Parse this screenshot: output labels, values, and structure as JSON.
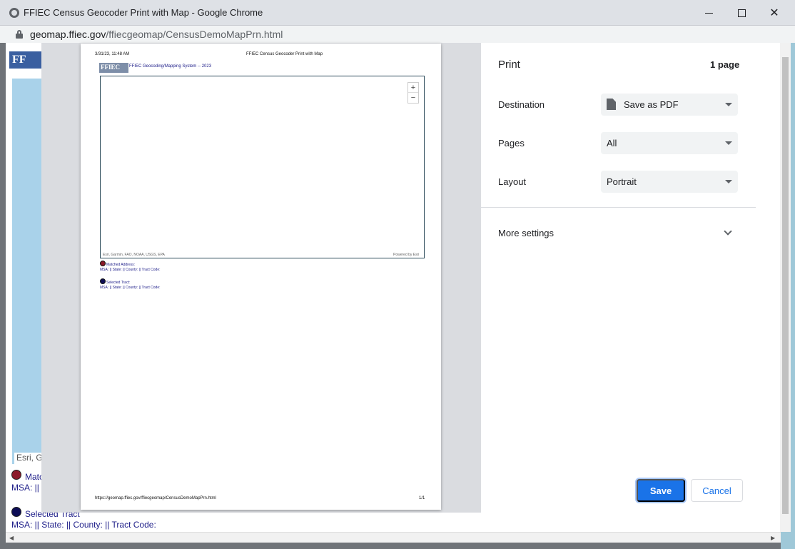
{
  "window": {
    "title": "FFIEC Census Geocoder Print with Map - Google Chrome",
    "url_host": "geomap.ffiec.gov",
    "url_path": "/ffiecgeomap/CensusDemoMapPrn.html"
  },
  "background_page": {
    "logo_text": "FF",
    "esri_text": "Esri, G",
    "matched_label": "Matc",
    "msa_line_1": "MSA: ||",
    "selected_label": "Selected Tract",
    "msa_line_2": "MSA: || State: || County: || Tract Code:"
  },
  "preview": {
    "date": "3/31/23, 11:48 AM",
    "header_title": "FFIEC Census Geocoder Print with Map",
    "logo_text": "FFIEC",
    "system_title": "FFIEC Geocoding/Mapping System -- 2023",
    "zoom_in": "+",
    "zoom_out": "−",
    "map_attribution": "Esri, Garmin, FAO, NOAA, USGS, EPA",
    "powered_by": "Powered by Esri",
    "matched_label": "Matched Address:",
    "matched_msa": "MSA: || State: || County: || Tract Code:",
    "selected_label": "Selected Tract:",
    "selected_msa": "MSA: || State: || County: || Tract Code:",
    "footer_url": "https://geomap.ffiec.gov/ffiecgeomap/CensusDemoMapPrn.html",
    "page_number": "1/1"
  },
  "print_settings": {
    "title": "Print",
    "page_count": "1 page",
    "destination_label": "Destination",
    "destination_value": "Save as PDF",
    "pages_label": "Pages",
    "pages_value": "All",
    "layout_label": "Layout",
    "layout_value": "Portrait",
    "more_settings_label": "More settings",
    "save_label": "Save",
    "cancel_label": "Cancel"
  },
  "colors": {
    "accent": "#1a73e8",
    "matched_marker": "#8b1a2a",
    "selected_marker": "#0c0c55"
  }
}
